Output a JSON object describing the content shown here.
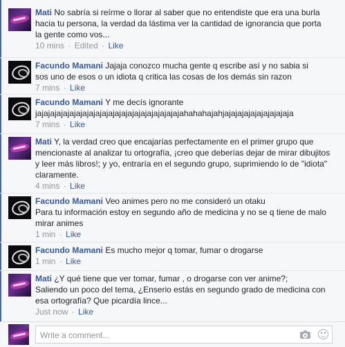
{
  "comments": [
    {
      "author": "Mati",
      "avatar": "mati-avatar",
      "text_lines": [
        "No sabría si reírme o llorar al saber que no entendiste que era una burla",
        "hacia tu persona, la verdad da lástima ver la cantidad de ignorancia que porta",
        "la gente como vos..."
      ],
      "time": "10 mins",
      "edited": "Edited",
      "like": "Like"
    },
    {
      "author": "Facundo Mamani",
      "avatar": "facundo-avatar",
      "text_lines": [
        "Jajaja conozco mucha gente q escribe así y no sabia si",
        "sos uno de esos o un idiota q critica las cosas de los demás sin razon"
      ],
      "time": "7 mins",
      "like": "Like"
    },
    {
      "author": "Facundo Mamani",
      "avatar": "facundo-avatar",
      "text_lines": [
        "Y  me decís ignorante",
        "jajajajajajajajajajajajajajajajajajajajajajajahahahajahjajajajajajajajajajaja"
      ],
      "time": "7 mins",
      "like": "Like"
    },
    {
      "author": "Mati",
      "avatar": "mati-avatar",
      "text_lines": [
        "Y, la verdad creo que encajarías perfectamente en el primer grupo que",
        "mencionaste al analizar tu ortografía, ¡creo que deberías dejar de mirar dibujitos",
        "y leer más libros!; y yo, entraría en el segundo grupo, suprimiendo lo de \"idiota\"",
        "claramente."
      ],
      "time": "4 mins",
      "like": "Like"
    },
    {
      "author": "Facundo Mamani",
      "avatar": "facundo-avatar",
      "text_lines": [
        "Veo animes pero no me consideró un otaku",
        "Para tu información estoy en segundo año de medicina y  no se q tiene de malo",
        "mirar animes"
      ],
      "time": "1 min",
      "like": "Like"
    },
    {
      "author": "Facundo Mamani",
      "avatar": "facundo-avatar",
      "text_lines": [
        "Es mucho mejor q tomar, fumar o drogarse"
      ],
      "time": "1 min",
      "like": "Like"
    },
    {
      "author": "Mati",
      "avatar": "mati-avatar",
      "text_lines": [
        "¿Y qué tiene que ver tomar, fumar , o drogarse con ver anime?;",
        "Saliendo un poco del tema, ¿Enserio estás en segundo grado de medicina con",
        "esa ortografía? Que picardía lince..."
      ],
      "time": "Just now",
      "like": "Like"
    }
  ],
  "composer": {
    "placeholder": "Write a comment...",
    "icons": [
      "camera-icon",
      "emoji-icon"
    ]
  },
  "colors": {
    "link": "#365899",
    "meta": "#90949c",
    "background": "#f6f7f9"
  }
}
